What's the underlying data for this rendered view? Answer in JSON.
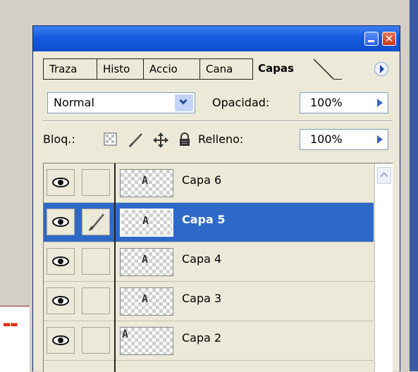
{
  "panel": {
    "tabs": [
      "Traza",
      "Histo",
      "Accio",
      "Cana",
      "Capas"
    ],
    "active_tab": "Capas"
  },
  "blend": {
    "mode": "Normal",
    "opacity_label": "Opacidad:",
    "opacity_value": "100%"
  },
  "lock": {
    "label": "Bloq.:",
    "fill_label": "Relleno:",
    "fill_value": "100%"
  },
  "layers": [
    {
      "name": "Capa 6",
      "selected": false,
      "visible": true,
      "brush": false
    },
    {
      "name": "Capa 5",
      "selected": true,
      "visible": true,
      "brush": true
    },
    {
      "name": "Capa 4",
      "selected": false,
      "visible": true,
      "brush": false
    },
    {
      "name": "Capa 3",
      "selected": false,
      "visible": true,
      "brush": false
    },
    {
      "name": "Capa 2",
      "selected": false,
      "visible": true,
      "brush": false
    }
  ],
  "colors": {
    "selection": "#2f69c8",
    "titlebar": "#1459e0",
    "panel_bg": "#ece9d8"
  }
}
